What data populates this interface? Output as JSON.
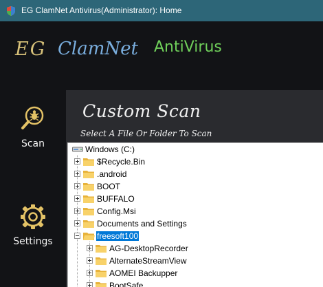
{
  "window": {
    "title": "EG ClamNet Antivirus(Administrator): Home"
  },
  "brand": {
    "part1": "EG",
    "part2": "ClamNet",
    "part3": "AntiVirus"
  },
  "sidebar": {
    "items": [
      {
        "label": "Scan",
        "icon": "bug-search-icon"
      },
      {
        "label": "Settings",
        "icon": "gear-icon"
      }
    ]
  },
  "main": {
    "title": "Custom Scan",
    "subtitle": "Select A File Or Folder To Scan"
  },
  "tree": {
    "root": "Windows (C:)",
    "items": [
      {
        "label": "$Recycle.Bin"
      },
      {
        "label": ".android"
      },
      {
        "label": "BOOT"
      },
      {
        "label": "BUFFALO"
      },
      {
        "label": "Config.Msi"
      },
      {
        "label": "Documents and Settings"
      },
      {
        "label": "freesoft100",
        "selected": true,
        "expanded": true
      },
      {
        "label": "AG-DesktopRecorder"
      },
      {
        "label": "AlternateStreamView"
      },
      {
        "label": "AOMEI Backupper"
      },
      {
        "label": "BootSafe"
      }
    ]
  },
  "colors": {
    "titlebar": "#2d6678",
    "background": "#121316",
    "panel": "#2a2b2f",
    "accent_gold": "#d8c27a",
    "accent_blue": "#7aaede",
    "accent_green": "#6fcf5a",
    "selection": "#0078d7"
  }
}
